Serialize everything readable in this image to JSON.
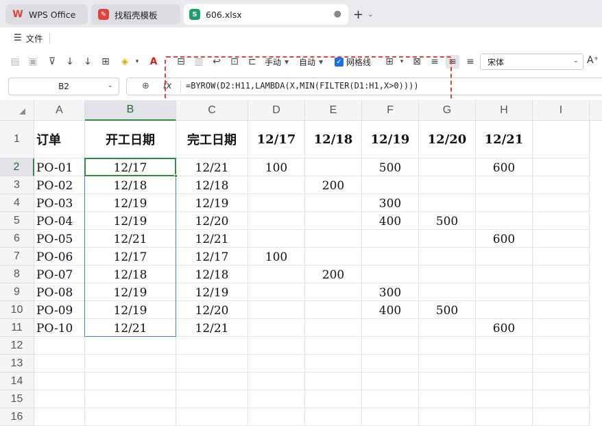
{
  "tabs": [
    {
      "label": "WPS Office",
      "icon": "wps-logo-icon"
    },
    {
      "label": "找稻壳模板",
      "icon": "docer-icon"
    },
    {
      "label": "606.xlsx",
      "icon": "sheet-file-icon",
      "close": "●"
    }
  ],
  "new_tab": "+",
  "menu": {
    "file_label": "文件"
  },
  "toolbar": {
    "hand_label": "手动",
    "auto_label": "自动",
    "gridlines_label": "网格线",
    "gridlines_checked": true,
    "font_name": "宋体"
  },
  "formula_bar": {
    "cell_ref": "B2",
    "fx": "fx",
    "formula": "=BYROW(D2:H11,LAMBDA(X,MIN(FILTER(D1:H1,X>0))))"
  },
  "sheet": {
    "columns": [
      "A",
      "B",
      "C",
      "D",
      "E",
      "F",
      "G",
      "H",
      "I"
    ],
    "rows": [
      "1",
      "2",
      "3",
      "4",
      "5",
      "6",
      "7",
      "8",
      "9",
      "10",
      "11",
      "12",
      "13",
      "14",
      "15",
      "16"
    ],
    "selected_cell": "B2",
    "header_row": [
      "订单",
      "开工日期",
      "完工日期",
      "12/17",
      "12/18",
      "12/19",
      "12/20",
      "12/21"
    ],
    "data": [
      [
        "PO-01",
        "12/17",
        "12/21",
        "100",
        "",
        "500",
        "",
        "600"
      ],
      [
        "PO-02",
        "12/18",
        "12/18",
        "",
        "200",
        "",
        "",
        ""
      ],
      [
        "PO-03",
        "12/19",
        "12/19",
        "",
        "",
        "300",
        "",
        ""
      ],
      [
        "PO-04",
        "12/19",
        "12/20",
        "",
        "",
        "400",
        "500",
        ""
      ],
      [
        "PO-05",
        "12/21",
        "12/21",
        "",
        "",
        "",
        "",
        "600"
      ],
      [
        "PO-06",
        "12/17",
        "12/17",
        "100",
        "",
        "",
        "",
        ""
      ],
      [
        "PO-07",
        "12/18",
        "12/18",
        "",
        "200",
        "",
        "",
        ""
      ],
      [
        "PO-08",
        "12/19",
        "12/19",
        "",
        "",
        "300",
        "",
        ""
      ],
      [
        "PO-09",
        "12/19",
        "12/20",
        "",
        "",
        "400",
        "500",
        ""
      ],
      [
        "PO-10",
        "12/21",
        "12/21",
        "",
        "",
        "",
        "",
        "600"
      ]
    ]
  },
  "colors": {
    "accent_green": "#2e8b3f",
    "selection_blue": "#3f7bd9",
    "highlight_red": "#e04040",
    "sheet_icon": "#1aa068"
  }
}
